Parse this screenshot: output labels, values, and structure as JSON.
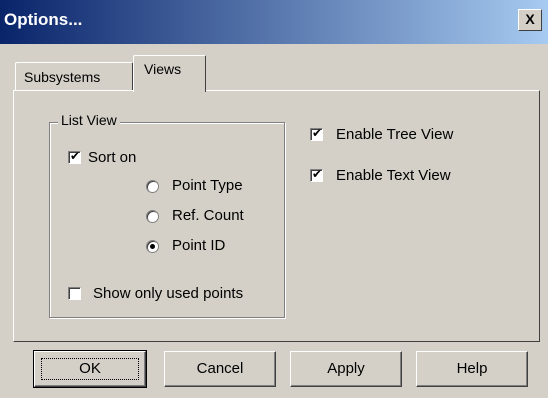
{
  "window": {
    "title": "Options...",
    "close_label": "X"
  },
  "tabs": [
    {
      "label": "Subsystems",
      "selected": false
    },
    {
      "label": "Views",
      "selected": true
    }
  ],
  "list_view": {
    "group_label": "List View",
    "sort_on": {
      "label": "Sort on",
      "checked": true
    },
    "sort_options": [
      {
        "label": "Point Type",
        "selected": false
      },
      {
        "label": "Ref. Count",
        "selected": false
      },
      {
        "label": "Point ID",
        "selected": true
      }
    ],
    "show_only_used": {
      "label": "Show only used points",
      "checked": false
    }
  },
  "options": {
    "enable_tree_view": {
      "label": "Enable Tree View",
      "checked": true
    },
    "enable_text_view": {
      "label": "Enable Text View",
      "checked": true
    }
  },
  "buttons": {
    "ok": "OK",
    "cancel": "Cancel",
    "apply": "Apply",
    "help": "Help"
  },
  "colors": {
    "title_bar_start": "#0a246a",
    "title_bar_end": "#a6caf0",
    "face": "#d4d0c8"
  },
  "check_mark": "✔"
}
